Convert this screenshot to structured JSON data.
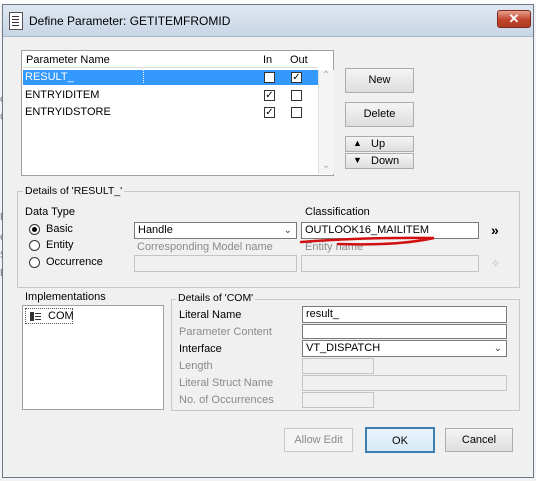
{
  "dialog": {
    "title": "Define Parameter: GETITEMFROMID",
    "close": "✕"
  },
  "background": {
    "frag1": "e",
    "frag2": "C",
    "frag3": "Pa",
    "frag4": "e",
    "frag5": "S",
    "frag6": "En"
  },
  "params": {
    "headers": {
      "name": "Parameter Name",
      "in": "In",
      "out": "Out"
    },
    "rows": [
      {
        "name": "RESULT_",
        "in": false,
        "out": true,
        "selected": true
      },
      {
        "name": "ENTRYIDITEM",
        "in": true,
        "out": false,
        "selected": false
      },
      {
        "name": "ENTRYIDSTORE",
        "in": true,
        "out": false,
        "selected": false
      }
    ]
  },
  "side_buttons": {
    "new": "New",
    "delete": "Delete",
    "up": "Up",
    "down": "Down"
  },
  "details": {
    "legend": "Details of 'RESULT_'",
    "data_type_label": "Data Type",
    "radios": [
      "Basic",
      "Entity",
      "Occurrence"
    ],
    "selected_radio": "Basic",
    "basic_value": "Handle",
    "corr_model_label": "Corresponding Model name",
    "classification_label": "Classification",
    "classification_value": "OUTLOOK16_MAILITEM",
    "entity_name_label": "Entity name",
    "chevron": "»"
  },
  "impl": {
    "label": "Implementations",
    "items": [
      "COM"
    ]
  },
  "com": {
    "legend": "Details of 'COM'",
    "literal_name_label": "Literal Name",
    "literal_name_value": "result_",
    "param_content_label": "Parameter Content",
    "interface_label": "Interface",
    "interface_value": "VT_DISPATCH",
    "length_label": "Length",
    "literal_struct_label": "Literal Struct Name",
    "occurrences_label": "No. of Occurrences"
  },
  "footer": {
    "allow_edit": "Allow Edit",
    "ok": "OK",
    "cancel": "Cancel"
  },
  "colors": {
    "selection": "#3399ff",
    "annotation": "#d01010"
  }
}
